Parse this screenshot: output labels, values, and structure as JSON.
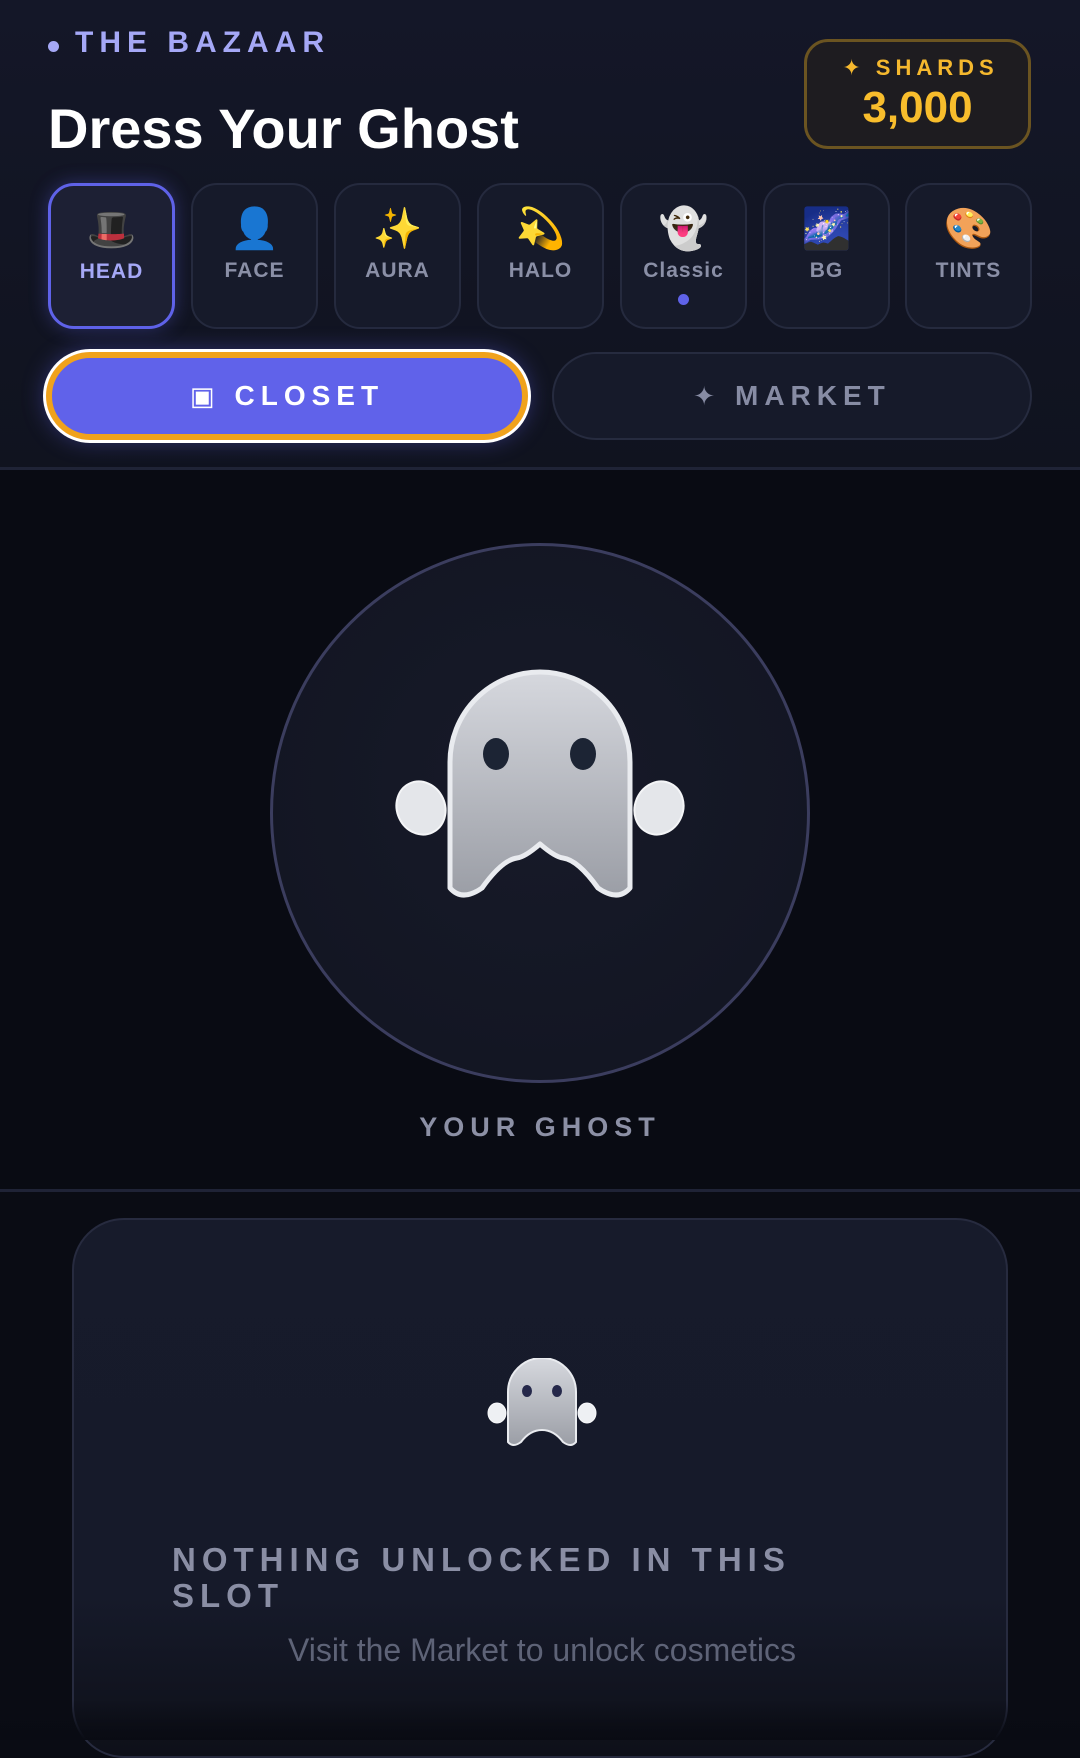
{
  "header": {
    "brand": "THE BAZAAR",
    "title": "Dress Your Ghost"
  },
  "shards": {
    "icon": "✦",
    "label": "SHARDS",
    "value": "3,000"
  },
  "categories": [
    {
      "emoji": "🎩",
      "label": "HEAD",
      "active": true,
      "indicator": false
    },
    {
      "emoji": "👤",
      "label": "FACE",
      "active": false,
      "indicator": false
    },
    {
      "emoji": "✨",
      "label": "AURA",
      "active": false,
      "indicator": false
    },
    {
      "emoji": "💫",
      "label": "HALO",
      "active": false,
      "indicator": false
    },
    {
      "emoji": "👻",
      "label": "Classic",
      "active": false,
      "indicator": true
    },
    {
      "emoji": "🌌",
      "label": "BG",
      "active": false,
      "indicator": false
    },
    {
      "emoji": "🎨",
      "label": "TINTS",
      "active": false,
      "indicator": false
    }
  ],
  "tabs": {
    "closet": {
      "icon": "▣",
      "label": "CLOSET",
      "selected": true
    },
    "market": {
      "icon": "✦",
      "label": "MARKET",
      "selected": false
    }
  },
  "preview": {
    "caption": "YOUR GHOST"
  },
  "empty_state": {
    "title": "NOTHING UNLOCKED IN THIS SLOT",
    "subtitle": "Visit the Market to unlock cosmetics"
  },
  "colors": {
    "accent": "#6062ea",
    "focus_ring": "#f0a21c",
    "gold": "#f8bd2c",
    "background": "#0a0c14"
  }
}
